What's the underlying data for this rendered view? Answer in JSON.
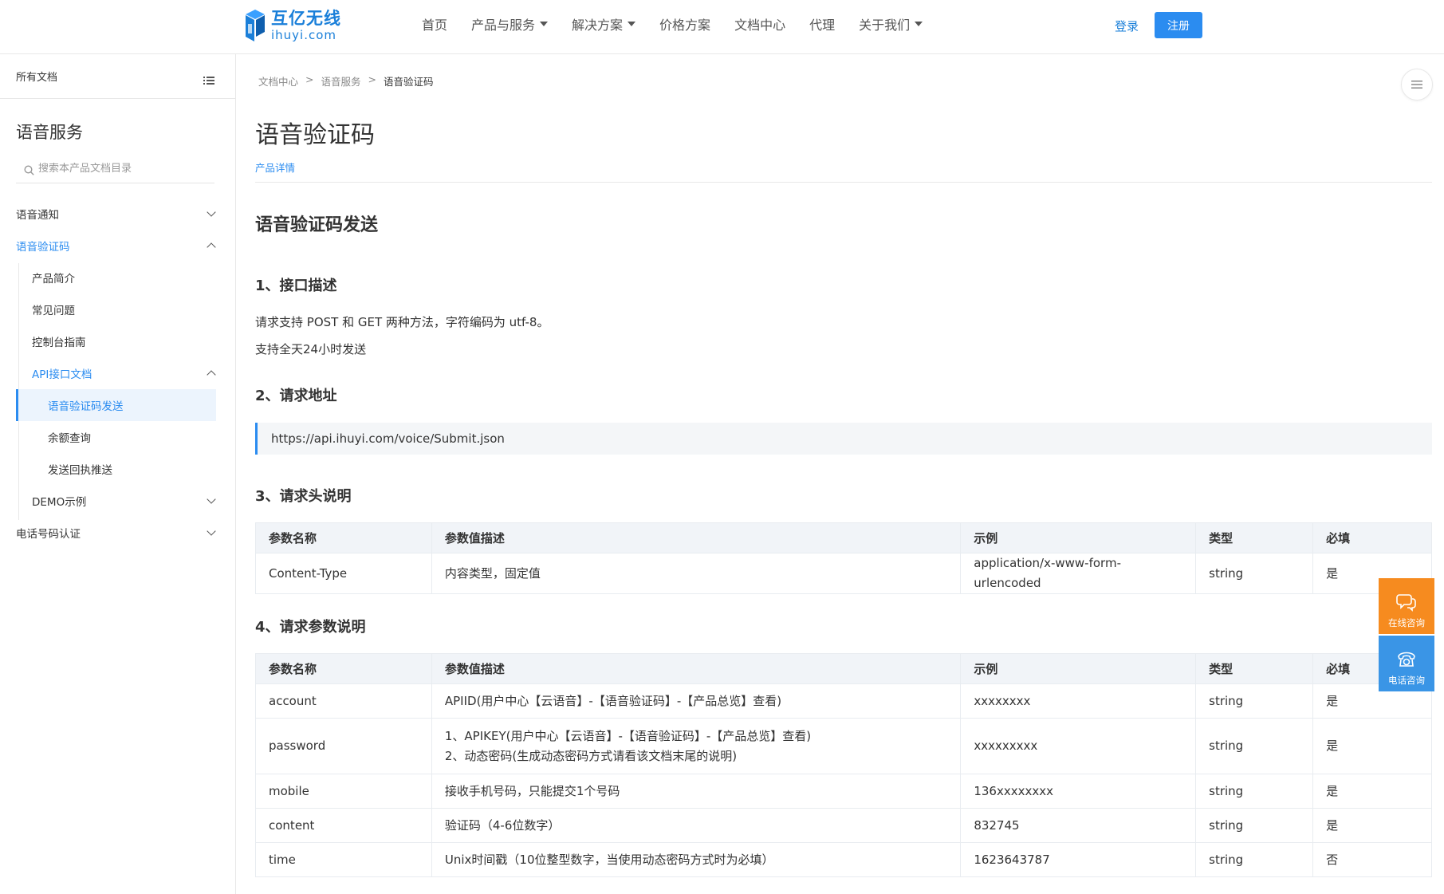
{
  "brand": {
    "name_cn": "互亿无线",
    "domain": "ihuyi.com",
    "color": "#1a7fd9"
  },
  "nav": {
    "items": [
      {
        "label": "首页",
        "has_dropdown": false
      },
      {
        "label": "产品与服务",
        "has_dropdown": true
      },
      {
        "label": "解决方案",
        "has_dropdown": true
      },
      {
        "label": "价格方案",
        "has_dropdown": false
      },
      {
        "label": "文档中心",
        "has_dropdown": false
      },
      {
        "label": "代理",
        "has_dropdown": false
      },
      {
        "label": "关于我们",
        "has_dropdown": true
      }
    ],
    "login": "登录",
    "register": "注册"
  },
  "sidebar": {
    "header": "所有文档",
    "title": "语音服务",
    "search_placeholder": "搜索本产品文档目录",
    "tree": [
      {
        "label": "语音通知",
        "state": "collapsed"
      },
      {
        "label": "语音验证码",
        "state": "expanded"
      },
      {
        "label": "产品简介"
      },
      {
        "label": "常见问题"
      },
      {
        "label": "控制台指南"
      },
      {
        "label": "API接口文档",
        "state": "expanded"
      },
      {
        "label": "语音验证码发送",
        "selected": true
      },
      {
        "label": "余额查询"
      },
      {
        "label": "发送回执推送"
      },
      {
        "label": "DEMO示例",
        "state": "collapsed"
      },
      {
        "label": "电话号码认证",
        "state": "collapsed"
      }
    ]
  },
  "breadcrumb": [
    "文档中心",
    ">",
    "语音服务",
    ">",
    "语音验证码"
  ],
  "page": {
    "title": "语音验证码",
    "detail_link": "产品详情",
    "section_title": "语音验证码发送",
    "s1": {
      "heading": "1、接口描述",
      "lines": [
        "请求支持 POST 和 GET 两种方法，字符编码为 utf-8。",
        "支持全天24小时发送"
      ]
    },
    "s2": {
      "heading": "2、请求地址",
      "url": "https://api.ihuyi.com/voice/Submit.json"
    },
    "s3": {
      "heading": "3、请求头说明",
      "columns": [
        "参数名称",
        "参数值描述",
        "示例",
        "类型",
        "必填"
      ],
      "rows": [
        [
          "Content-Type",
          "内容类型，固定值",
          "application/x-www-form-urlencoded",
          "string",
          "是"
        ]
      ]
    },
    "s4": {
      "heading": "4、请求参数说明",
      "columns": [
        "参数名称",
        "参数值描述",
        "示例",
        "类型",
        "必填"
      ],
      "rows": [
        [
          "account",
          "APIID(用户中心【云语音】-【语音验证码】-【产品总览】查看)",
          "xxxxxxxx",
          "string",
          "是"
        ],
        [
          "password",
          "1、APIKEY(用户中心【云语音】-【语音验证码】-【产品总览】查看)",
          "xxxxxxxxx",
          "string",
          "是"
        ],
        [
          "mobile",
          "接收手机号码，只能提交1个号码",
          "136xxxxxxxx",
          "string",
          "是"
        ],
        [
          "content",
          "验证码（4-6位数字）",
          "832745",
          "string",
          "是"
        ],
        [
          "time",
          "Unix时间戳（10位整型数字，当使用动态密码方式时为必填）",
          "1623643787",
          "string",
          "否"
        ]
      ],
      "password_desc_line2": "2、动态密码(生成动态密码方式请看该文档末尾的说明)"
    }
  },
  "float": {
    "online": {
      "label": "在线咨询",
      "color": "#f68b1f"
    },
    "phone": {
      "label": "电话咨询",
      "color": "#3a95e6"
    }
  }
}
